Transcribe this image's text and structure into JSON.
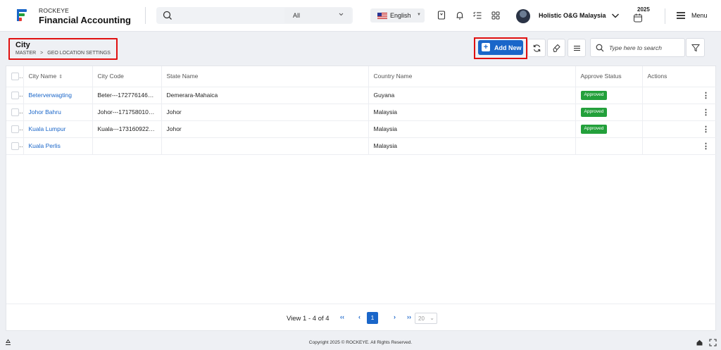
{
  "app": {
    "brand_top": "ROCKEYE",
    "brand_main": "Financial Accounting"
  },
  "topbar": {
    "search_placeholder": "",
    "search_scope": "All",
    "language": "English",
    "company": "Holistic O&G Malaysia",
    "year": "2025",
    "menu_label": "Menu"
  },
  "page": {
    "title": "City",
    "breadcrumb": [
      "MASTER",
      "GEO LOCATION SETTINGS"
    ],
    "breadcrumb_sep": ">"
  },
  "toolbar": {
    "add_new_label": "Add New",
    "search_placeholder": "Type here to search"
  },
  "table": {
    "columns": [
      "City Name",
      "City Code",
      "State Name",
      "Country Name",
      "Approve Status",
      "Actions"
    ],
    "rows": [
      {
        "city": "Beterverwagting",
        "code": "Beter---17277614653...",
        "state": "Demerara-Mahaica",
        "country": "Guyana",
        "status": "Approved"
      },
      {
        "city": "Johor Bahru",
        "code": "Johor---17175801067...",
        "state": "Johor",
        "country": "Malaysia",
        "status": "Approved"
      },
      {
        "city": "Kuala Lumpur",
        "code": "Kuala---17316092217...",
        "state": "Johor",
        "country": "Malaysia",
        "status": "Approved"
      },
      {
        "city": "Kuala Perlis",
        "code": "",
        "state": "",
        "country": "Malaysia",
        "status": ""
      }
    ]
  },
  "pagination": {
    "view_text": "View 1 - 4 of 4",
    "current_page": "1",
    "page_size": "20"
  },
  "footer": {
    "copyright": "Copyright 2025 © ROCKEYE. All Rights Reserved."
  },
  "colors": {
    "primary": "#1a66c9",
    "approved": "#23a03b",
    "highlight": "#e01010"
  }
}
